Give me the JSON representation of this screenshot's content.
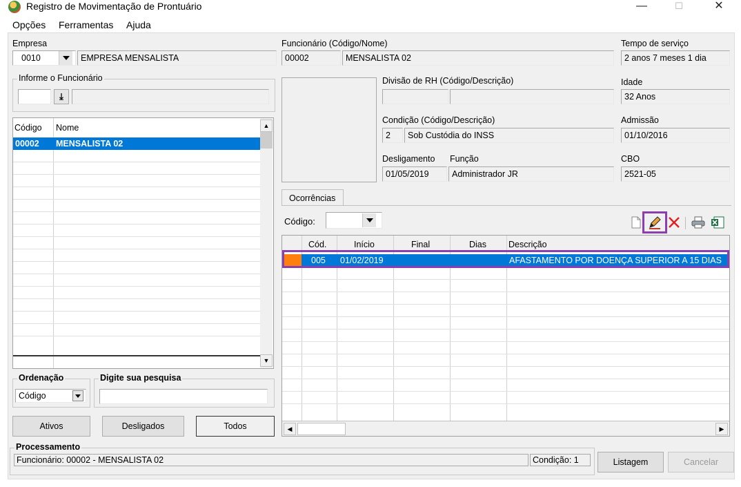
{
  "window": {
    "title": "Registro de Movimentação de Prontuário",
    "minimize": "—",
    "maximize": "☐",
    "close": "✕"
  },
  "menu": [
    "Opções",
    "Ferramentas",
    "Ajuda"
  ],
  "empresa": {
    "label": "Empresa",
    "code": "0010",
    "name": "EMPRESA MENSALISTA"
  },
  "funcionario": {
    "label": "Funcionário (Código/Nome)",
    "code": "00002",
    "name": "MENSALISTA 02"
  },
  "tempo_servico": {
    "label": "Tempo de serviço",
    "value": "2 anos 7 meses 1 dia"
  },
  "informe": {
    "label": "Informe o Funcionário",
    "value": ""
  },
  "divisao": {
    "label": "Divisão de RH (Código/Descrição)",
    "code": "",
    "desc": ""
  },
  "idade": {
    "label": "Idade",
    "value": "32 Anos"
  },
  "condicao": {
    "label": "Condição (Código/Descrição)",
    "code": "2",
    "desc": "Sob Custódia do INSS"
  },
  "admissao": {
    "label": "Admissão",
    "value": "01/10/2016"
  },
  "desligamento": {
    "label": "Desligamento",
    "value": "01/05/2019"
  },
  "funcao": {
    "label": "Função",
    "value": "Administrador JR"
  },
  "cbo": {
    "label": "CBO",
    "value": "2521-05"
  },
  "emp_list": {
    "headers": [
      "Código",
      "Nome"
    ],
    "rows": [
      {
        "code": "00002",
        "name": "MENSALISTA 02"
      }
    ]
  },
  "ordenacao": {
    "label": "Ordenação",
    "value": "Código"
  },
  "pesquisa": {
    "label": "Digite sua pesquisa",
    "value": ""
  },
  "buttons": {
    "ativos": "Ativos",
    "desligados": "Desligados",
    "todos": "Todos",
    "listagem": "Listagem",
    "cancelar": "Cancelar"
  },
  "ocorrencias": {
    "tab": "Ocorrências",
    "codigo_label": "Código:",
    "codigo_value": "",
    "headers": [
      "Cód.",
      "Início",
      "Final",
      "Dias",
      "Descrição"
    ],
    "rows": [
      {
        "cod": "005",
        "inicio": "01/02/2019",
        "final": "",
        "dias": "",
        "descricao": "AFASTAMENTO POR DOENÇA SUPERIOR A 15 DIAS"
      }
    ]
  },
  "processamento": {
    "label": "Processamento",
    "status": "Funcionário: 00002 - MENSALISTA 02",
    "condicao": "Condição: 1"
  },
  "colors": {
    "selection": "#0078d7",
    "highlight": "#8b3fae",
    "row_marker": "#ff7f0e"
  }
}
